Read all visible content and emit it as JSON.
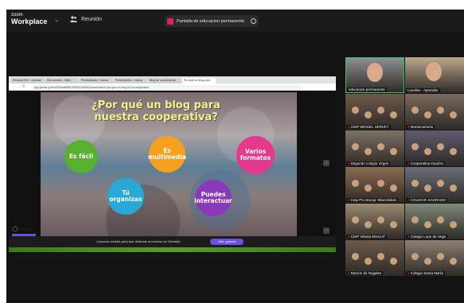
{
  "app": {
    "brand_small": "zoom",
    "brand_big": "Workplace"
  },
  "meeting": {
    "label": "Reunión"
  },
  "share_indicator": {
    "text": "Pantalla de educacion permanente"
  },
  "browser": {
    "tabs": [
      "Revista CNC - culturas",
      "Mis cuentos - Taller",
      "Presentación - Canva",
      "Presentación - Canva",
      "Blog de cooperativas",
      "Por qué un blog para"
    ],
    "url": "app.genial.ly/view/63a4a89ffb7650012ae5b0/presentation-por-que-un-blog-en-la-cooperativa"
  },
  "slide": {
    "title": "¿Por qué un blog para nuestra cooperativa?",
    "bubbles": [
      {
        "text": "Es fácil",
        "color": "#58b030"
      },
      {
        "text": "Es multimedia",
        "color": "#f5a11f"
      },
      {
        "text": "Varios formatos",
        "color": "#e5398c"
      },
      {
        "text": "Tú organizas",
        "color": "#29a8d8"
      },
      {
        "text": "Puedes interactuar",
        "color": "#8a3ab9"
      }
    ],
    "brand": "genially"
  },
  "cookie_bar": {
    "text": "¡Usamos cookies para que disfrutes al máximo de Genially!",
    "button": "Vale, gracias"
  },
  "participants": [
    {
      "name": "educacion permanente",
      "speaking": true,
      "muted": false,
      "bg": "#8d8f93"
    },
    {
      "name": "Lourdes - Aprender",
      "speaking": false,
      "muted": false,
      "bg": "#b9a88d"
    },
    {
      "name": "CEIP MIGUEL SERVET",
      "speaking": false,
      "muted": true,
      "bg": "#6e5a4b"
    },
    {
      "name": "Montecarmelo",
      "speaking": false,
      "muted": true,
      "bg": "#7a6a5d"
    },
    {
      "name": "Segundo colegio Virgen",
      "speaking": false,
      "muted": true,
      "bg": "#7d7266"
    },
    {
      "name": "Cooperativa Impulso",
      "speaking": false,
      "muted": true,
      "bg": "#5f5b6e"
    },
    {
      "name": "Ceip Pío Baroja Villarrobledo",
      "speaking": false,
      "muted": true,
      "bg": "#8a6c52"
    },
    {
      "name": "COLEGIO SAGRADO",
      "speaking": false,
      "muted": true,
      "bg": "#6a6f78"
    },
    {
      "name": "CEIP Infanta Elena 5º",
      "speaking": false,
      "muted": true,
      "bg": "#9a8a72"
    },
    {
      "name": "Colegio Lope de Vega",
      "speaking": false,
      "muted": true,
      "bg": "#7e8a78"
    },
    {
      "name": "Ramón de Nogales",
      "speaking": false,
      "muted": true,
      "bg": "#6c5a4a"
    },
    {
      "name": "Colegio Santa María",
      "speaking": false,
      "muted": true,
      "bg": "#8c8074"
    }
  ]
}
